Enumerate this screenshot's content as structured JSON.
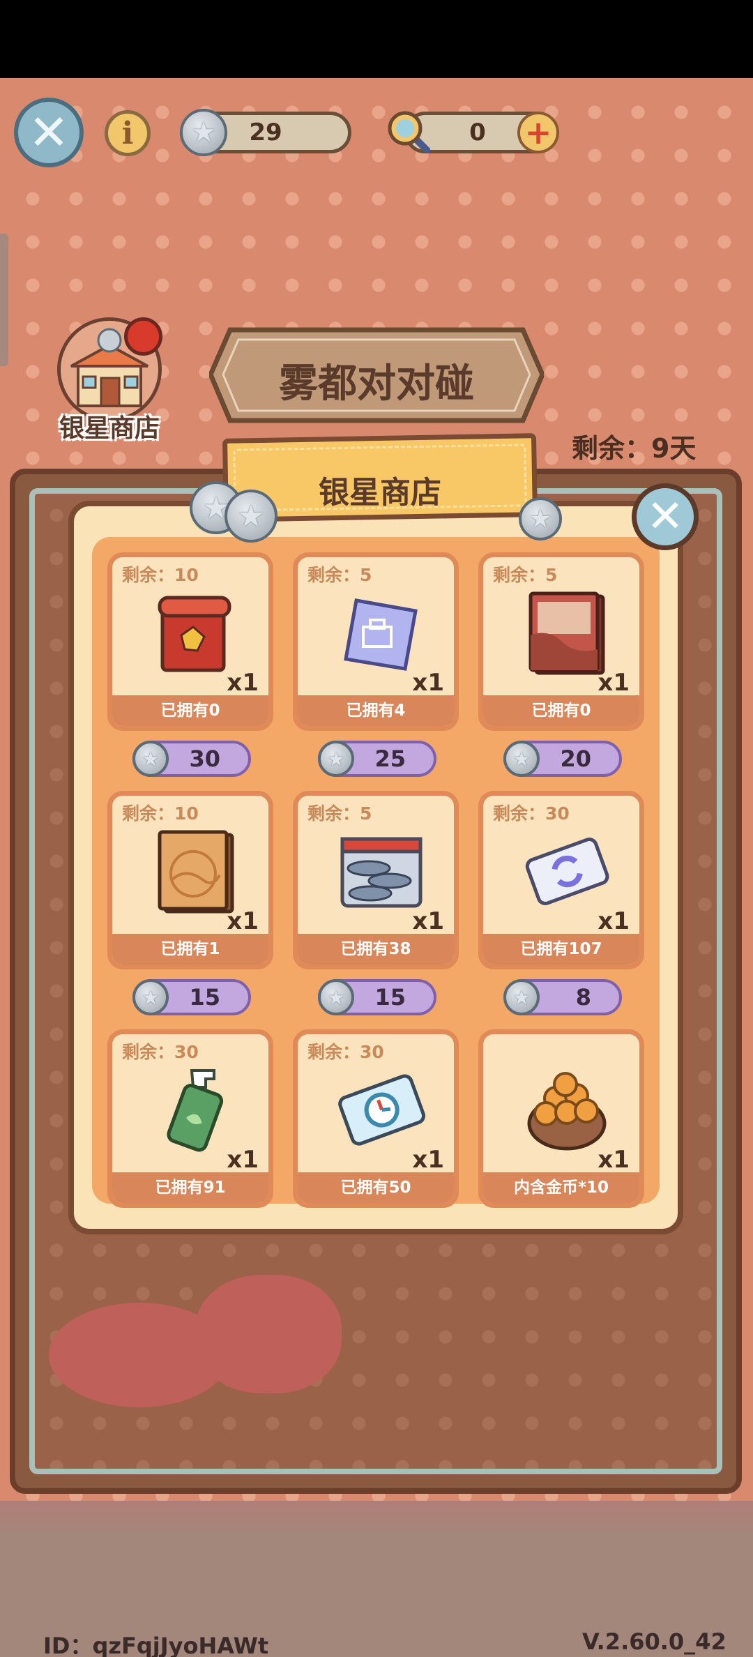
{
  "topbar": {
    "silver_star_count": "29",
    "magnifier_count": "0"
  },
  "event": {
    "shop_button_label": "银星商店",
    "title": "雾都对对碰",
    "remaining_days": "剩余：9天"
  },
  "shop": {
    "title": "银星商店",
    "items": [
      {
        "remain": "剩余：10",
        "qty": "x1",
        "owned": "已拥有0",
        "price": "30",
        "icon": "red-scroll-icon"
      },
      {
        "remain": "剩余：5",
        "qty": "x1",
        "owned": "已拥有4",
        "price": "25",
        "icon": "blueprint-scroll-icon"
      },
      {
        "remain": "剩余：5",
        "qty": "x1",
        "owned": "已拥有0",
        "price": "20",
        "icon": "red-book-icon"
      },
      {
        "remain": "剩余：10",
        "qty": "x1",
        "owned": "已拥有1",
        "price": "15",
        "icon": "orange-book-icon"
      },
      {
        "remain": "剩余：5",
        "qty": "x1",
        "owned": "已拥有38",
        "price": "15",
        "icon": "fish-crate-icon"
      },
      {
        "remain": "剩余：30",
        "qty": "x1",
        "owned": "已拥有107",
        "price": "8",
        "icon": "refresh-card-icon"
      },
      {
        "remain": "剩余：30",
        "qty": "x1",
        "owned": "已拥有91",
        "price": "",
        "icon": "spray-bottle-icon"
      },
      {
        "remain": "剩余：30",
        "qty": "x1",
        "owned": "已拥有50",
        "price": "",
        "icon": "clock-card-icon"
      },
      {
        "remain": "",
        "qty": "x1",
        "owned": "内含金币*10",
        "price": "",
        "icon": "gold-coin-bag-icon"
      }
    ]
  },
  "footer": {
    "id": "ID：qzFqjJyoHAWt",
    "version": "V.2.60.0_42"
  },
  "colors": {
    "background": "#d98a6e",
    "panel": "#fbe3b8",
    "price_pill": "#c2a8de",
    "owned_bar": "#d8865a"
  }
}
